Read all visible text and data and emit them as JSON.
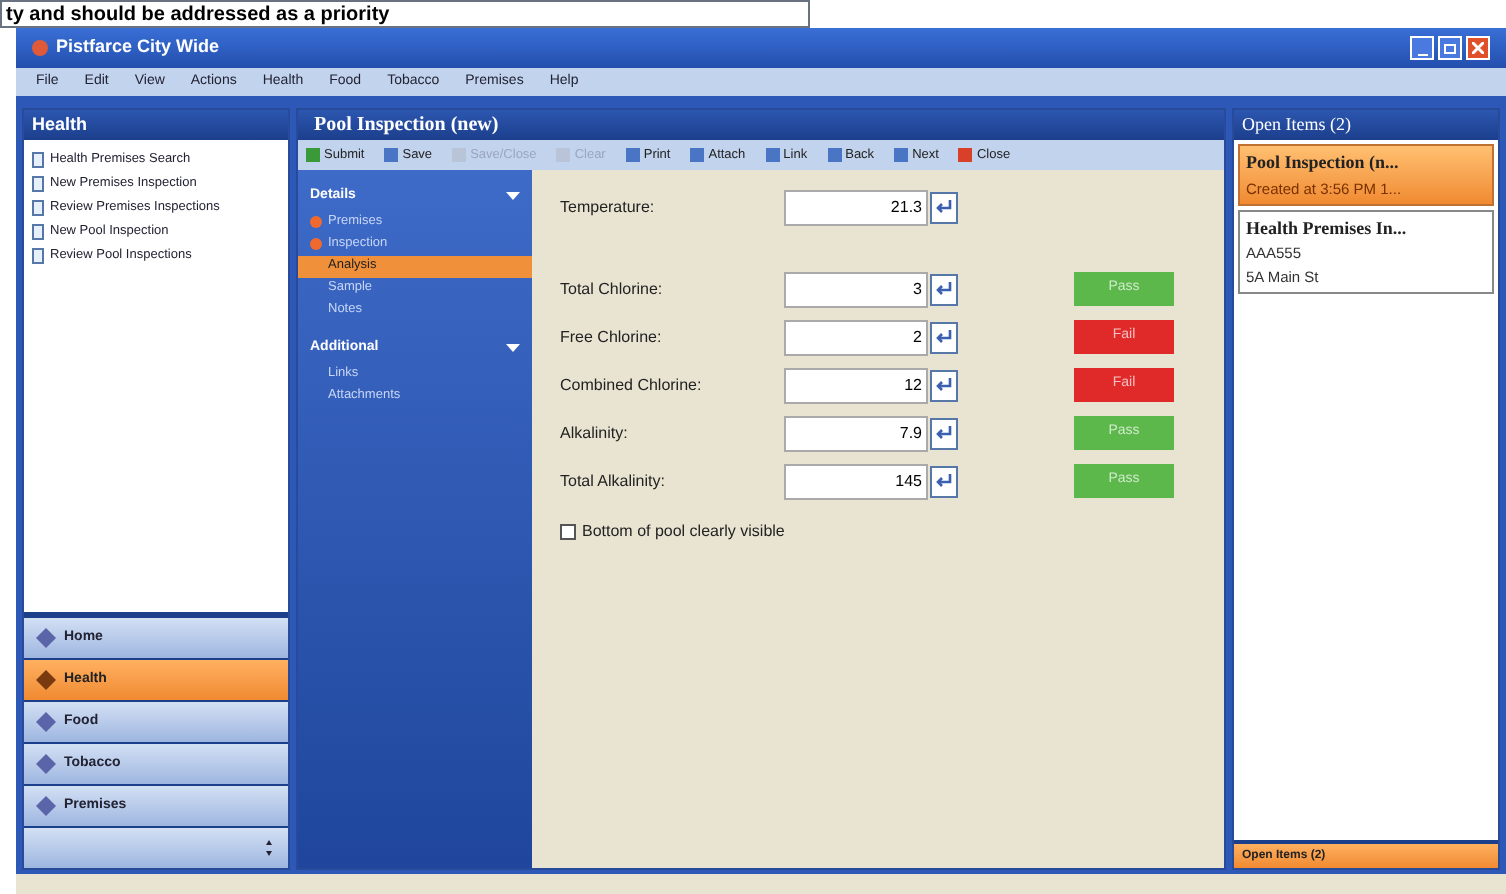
{
  "callout": {
    "text": "ty and should be addressed as a priority"
  },
  "window": {
    "title": "Pistfarce City Wide"
  },
  "menu": [
    "File",
    "Edit",
    "View",
    "Actions",
    "Health",
    "Food",
    "Tobacco",
    "Premises",
    "Help"
  ],
  "sidebar": {
    "title": "Health",
    "tasks": [
      {
        "label": "Health Premises Search"
      },
      {
        "label": "New Premises Inspection"
      },
      {
        "label": "Review Premises Inspections"
      },
      {
        "label": "New Pool Inspection"
      },
      {
        "label": "Review Pool Inspections"
      }
    ],
    "modules": [
      {
        "label": "Home",
        "selected": false
      },
      {
        "label": "Health",
        "selected": true
      },
      {
        "label": "Food",
        "selected": false
      },
      {
        "label": "Tobacco",
        "selected": false
      },
      {
        "label": "Premises",
        "selected": false
      }
    ]
  },
  "document": {
    "title": "Pool Inspection (new)",
    "toolbar": [
      {
        "label": "Submit",
        "disabled": false
      },
      {
        "label": "Save",
        "disabled": false
      },
      {
        "label": "Save/Close",
        "disabled": true
      },
      {
        "label": "Clear",
        "disabled": true
      },
      {
        "label": "Print",
        "disabled": false
      },
      {
        "label": "Attach",
        "disabled": false
      },
      {
        "label": "Link",
        "disabled": false
      },
      {
        "label": "Back",
        "disabled": false
      },
      {
        "label": "Next",
        "disabled": false
      },
      {
        "label": "Close",
        "disabled": false
      }
    ],
    "nav": [
      {
        "title": "Details",
        "items": [
          {
            "label": "Premises",
            "warning": true,
            "selected": false
          },
          {
            "label": "Inspection",
            "warning": true,
            "selected": false
          },
          {
            "label": "Analysis",
            "warning": false,
            "selected": true
          },
          {
            "label": "Sample",
            "warning": false,
            "selected": false
          },
          {
            "label": "Notes",
            "warning": false,
            "selected": false
          }
        ]
      },
      {
        "title": "Additional",
        "items": [
          {
            "label": "Links",
            "warning": false,
            "selected": false
          },
          {
            "label": "Attachments",
            "warning": false,
            "selected": false
          }
        ]
      }
    ],
    "fields": [
      {
        "label": "Temperature:",
        "value": "21.3"
      },
      {
        "label": "Total Chlorine:",
        "value": "3",
        "result": "Pass",
        "color": "#5cb84a"
      },
      {
        "label": "Free Chlorine:",
        "value": "2",
        "result": "Fail",
        "color": "#e02a2a"
      },
      {
        "label": "Combined Chlorine:",
        "value": "12",
        "result": "Fail",
        "color": "#e02a2a"
      },
      {
        "label": "Alkalinity:",
        "value": "7.9",
        "result": "Pass",
        "color": "#5cb84a"
      },
      {
        "label": "Total Alkalinity:",
        "value": "145",
        "result": "Pass",
        "color": "#5cb84a"
      }
    ],
    "checkbox": {
      "label": "Bottom of pool clearly visible",
      "checked": false
    }
  },
  "open_items": {
    "title": "Open Items (2)",
    "items": [
      {
        "title": "Pool Inspection (n...",
        "lines": [
          "Created at 3:56 PM 1..."
        ],
        "selected": true
      },
      {
        "title": "Health Premises In...",
        "lines": [
          "AAA555",
          "5A Main St"
        ],
        "selected": false
      }
    ],
    "footer": "Open Items (2)"
  }
}
